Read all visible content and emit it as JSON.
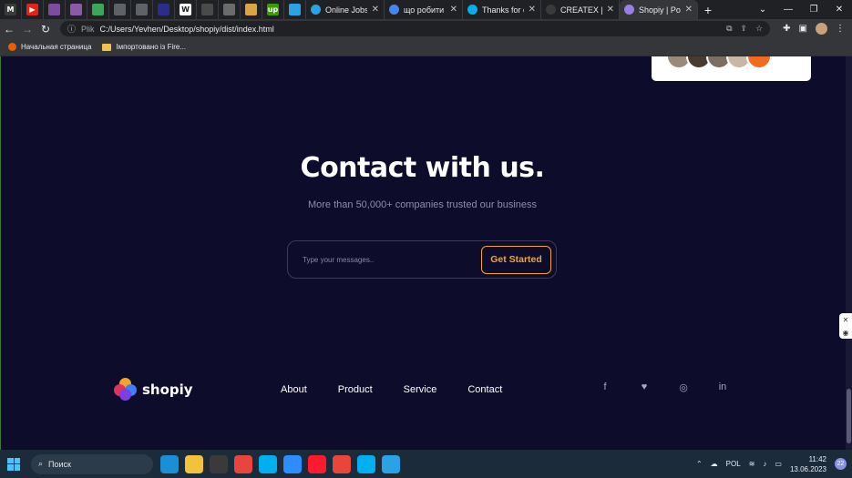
{
  "browser": {
    "pinned_tabs": [
      {
        "icon": "m-icon",
        "label": "M",
        "color": "#3a3a3a"
      },
      {
        "icon": "youtube-icon",
        "label": "▶",
        "color": "#e62117"
      },
      {
        "icon": "book-icon",
        "label": "",
        "color": "#7b4ca0"
      },
      {
        "icon": "book-icon",
        "label": "",
        "color": "#8a5aa8"
      },
      {
        "icon": "leaf-icon",
        "label": "",
        "color": "#3aa657"
      },
      {
        "icon": "globe-icon",
        "label": "",
        "color": "#5f6368"
      },
      {
        "icon": "globe-icon",
        "label": "",
        "color": "#5f6368"
      },
      {
        "icon": "triangle-icon",
        "label": "",
        "color": "#2c2c8a"
      },
      {
        "icon": "w3-icon",
        "label": "W",
        "color": "#ffffff"
      },
      {
        "icon": "grid-icon",
        "label": "",
        "color": "#4a4a4a"
      },
      {
        "icon": "openai-icon",
        "label": "",
        "color": "#6b6b6b"
      },
      {
        "icon": "book-icon",
        "label": "",
        "color": "#d9a441"
      },
      {
        "icon": "upwork-icon",
        "label": "up",
        "color": "#37a000"
      },
      {
        "icon": "send-icon",
        "label": "",
        "color": "#2aa3e6"
      }
    ],
    "tabs": [
      {
        "title": "Online Jobs | F",
        "icon": "send-icon",
        "icon_color": "#2aa3e6",
        "active": false
      },
      {
        "title": "що робити як",
        "icon": "google-icon",
        "icon_color": "#4285f4",
        "active": false
      },
      {
        "title": "Thanks for dow",
        "icon": "skype-icon",
        "icon_color": "#00aff0",
        "active": false
      },
      {
        "title": "CREATEX | Cou",
        "icon": "dash-icon",
        "icon_color": "#3a3a3a",
        "active": false
      },
      {
        "title": "Shopiy | Powe",
        "icon": "dash-icon",
        "icon_color": "#9b7de8",
        "active": true
      }
    ],
    "new_tab": "+",
    "window_controls": [
      "⌄",
      "—",
      "❐",
      "✕"
    ],
    "address": {
      "protocol_label": "Plik",
      "url": "C:/Users/Yevhen/Desktop/shopiy/dist/index.html"
    },
    "bookmarks": [
      {
        "label": "Начальная страница",
        "icon": "firefox-icon"
      },
      {
        "label": "Імпортовано із Fire...",
        "icon": "folder-icon"
      }
    ]
  },
  "page": {
    "contact": {
      "title": "Contact with us.",
      "subtitle": "More than 50,000+ companies trusted our business",
      "input_placeholder": "Type your messages..",
      "button_label": "Get Started"
    },
    "footer": {
      "brand": "shopiy",
      "nav": [
        "About",
        "Product",
        "Service",
        "Contact"
      ],
      "social": [
        {
          "icon": "facebook-icon",
          "glyph": "f"
        },
        {
          "icon": "twitter-icon",
          "glyph": "🐦"
        },
        {
          "icon": "instagram-icon",
          "glyph": "◘"
        },
        {
          "icon": "linkedin-icon",
          "glyph": "in"
        }
      ]
    },
    "colors": {
      "background": "#0e0c2b",
      "accent": "#f5a524"
    }
  },
  "taskbar": {
    "search_label": "Поиск",
    "language": "POL",
    "time": "11:42",
    "date": "13.06.2023",
    "notifications": "22",
    "apps": [
      {
        "icon": "edge-icon",
        "color": "#1b8fd6"
      },
      {
        "icon": "explorer-icon",
        "color": "#f3c13a"
      },
      {
        "icon": "store-icon",
        "color": "#3a3a3a"
      },
      {
        "icon": "chrome-icon",
        "color": "#e8453c"
      },
      {
        "icon": "skype-icon",
        "color": "#00aff0"
      },
      {
        "icon": "zoom-icon",
        "color": "#2d8cff"
      },
      {
        "icon": "opera-icon",
        "color": "#ff1b2d"
      },
      {
        "icon": "chrome-icon",
        "color": "#e8453c"
      },
      {
        "icon": "skype-icon",
        "color": "#00aff0"
      },
      {
        "icon": "telegram-icon",
        "color": "#2aa3e6"
      }
    ]
  }
}
